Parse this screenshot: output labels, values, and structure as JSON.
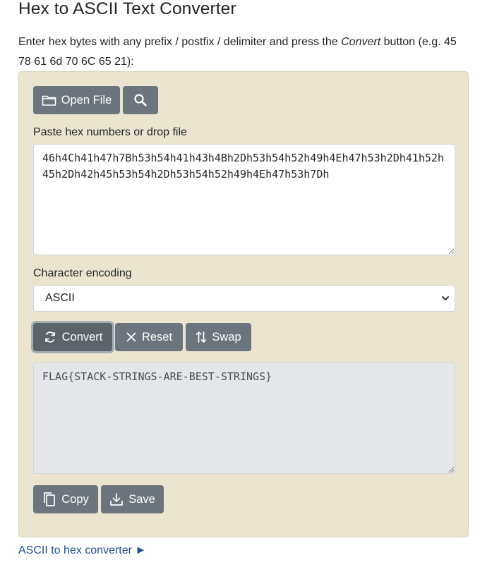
{
  "page": {
    "title": "Hex to ASCII Text Converter",
    "intro_before": "Enter hex bytes with any prefix / postfix / delimiter and press the ",
    "intro_emph": "Convert",
    "intro_after": " button (e.g. 45 78 61 6d 70 6C 65 21):"
  },
  "toolbar": {
    "open_file_label": "Open File",
    "open_file_icon": "folder-icon",
    "search_icon": "search-icon"
  },
  "input": {
    "label": "Paste hex numbers or drop file",
    "value": "46h4Ch41h47h7Bh53h54h41h43h4Bh2Dh53h54h52h49h4Eh47h53h2Dh41h52h45h2Dh42h45h53h54h2Dh53h54h52h49h4Eh47h53h7Dh"
  },
  "encoding": {
    "label": "Character encoding",
    "selected": "ASCII"
  },
  "actions": {
    "convert_label": "Convert",
    "reset_label": "Reset",
    "swap_label": "Swap"
  },
  "output": {
    "value": "FLAG{STACK-STRINGS-ARE-BEST-STRINGS}"
  },
  "output_actions": {
    "copy_label": "Copy",
    "save_label": "Save"
  },
  "footer": {
    "link_label": "ASCII to hex converter ►"
  },
  "colors": {
    "panel_bg": "#ebe5d0",
    "button_bg": "#6c757d",
    "output_bg": "#e4e7ea",
    "link": "#1d4f91"
  }
}
